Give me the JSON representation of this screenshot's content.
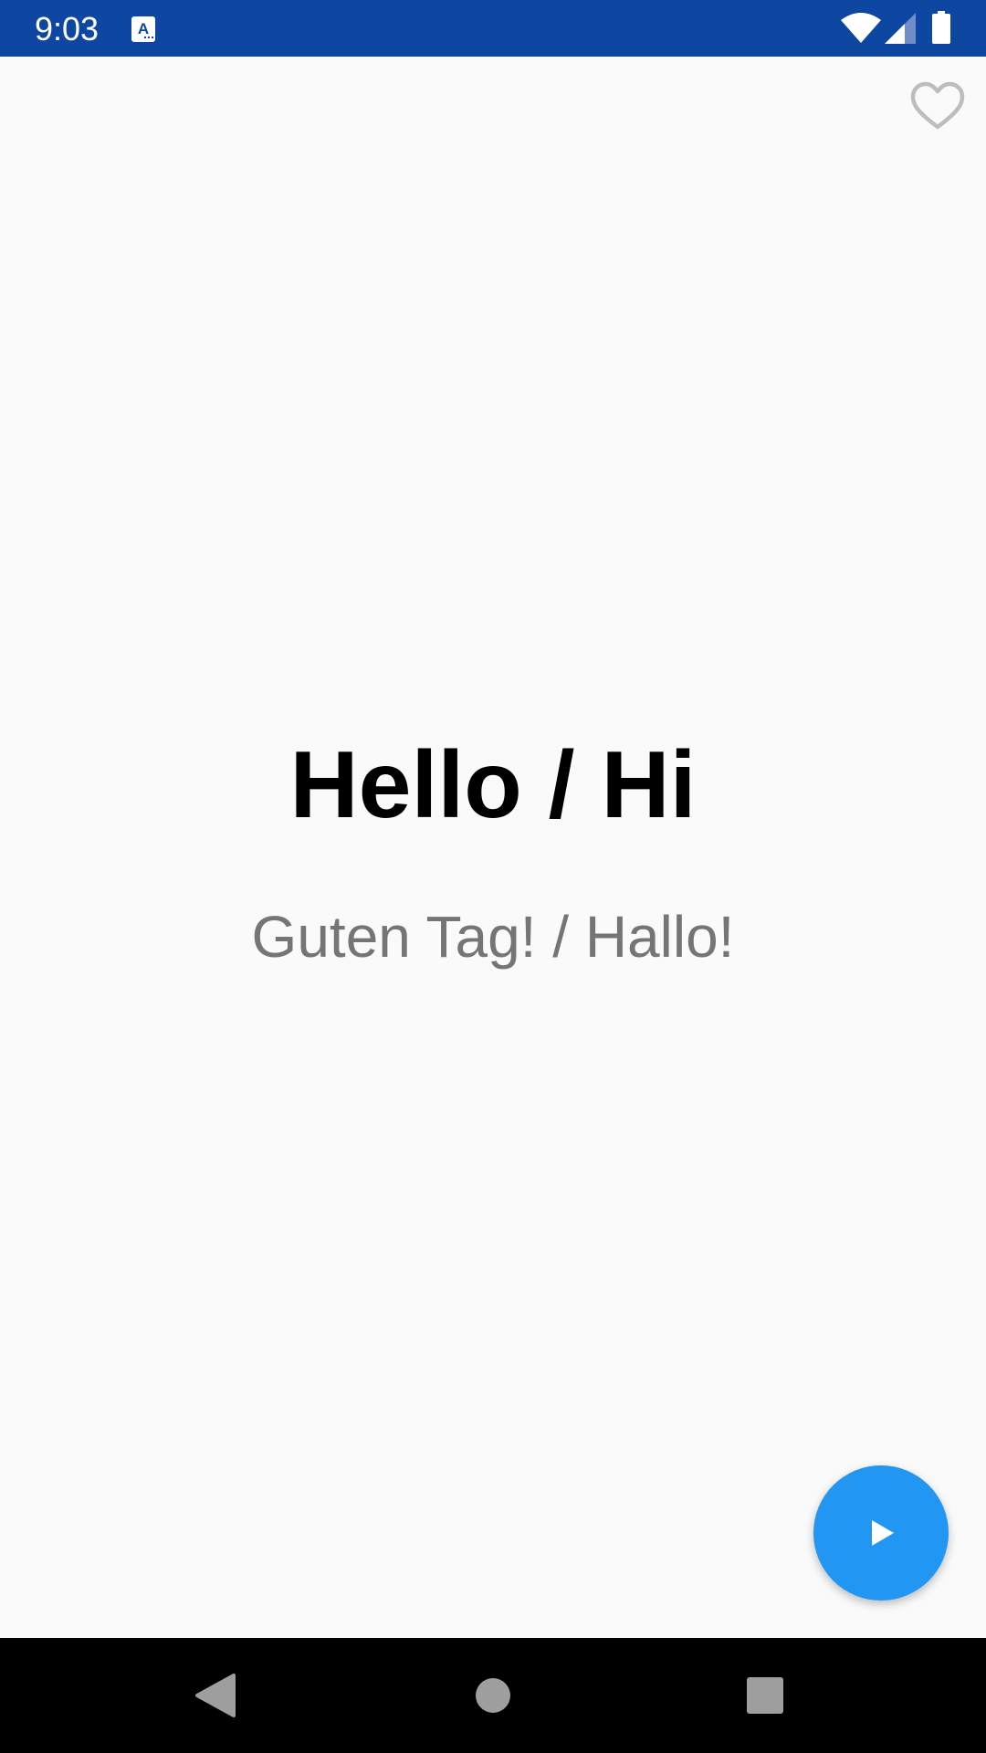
{
  "status_bar": {
    "time": "9:03",
    "app_icon": "translate-a-icon",
    "wifi_icon": "wifi-icon",
    "signal_icon": "cell-signal-icon",
    "battery_icon": "battery-icon",
    "background_color": "#0d47a1"
  },
  "toolbar": {
    "favorite_icon": "heart-outline-icon"
  },
  "phrase": {
    "primary": "Hello / Hi",
    "secondary": "Guten Tag! / Hallo!"
  },
  "fab": {
    "icon": "play-icon",
    "color": "#2196f3"
  },
  "nav_bar": {
    "back_icon": "back-triangle-icon",
    "home_icon": "home-circle-icon",
    "recents_icon": "recents-square-icon"
  }
}
